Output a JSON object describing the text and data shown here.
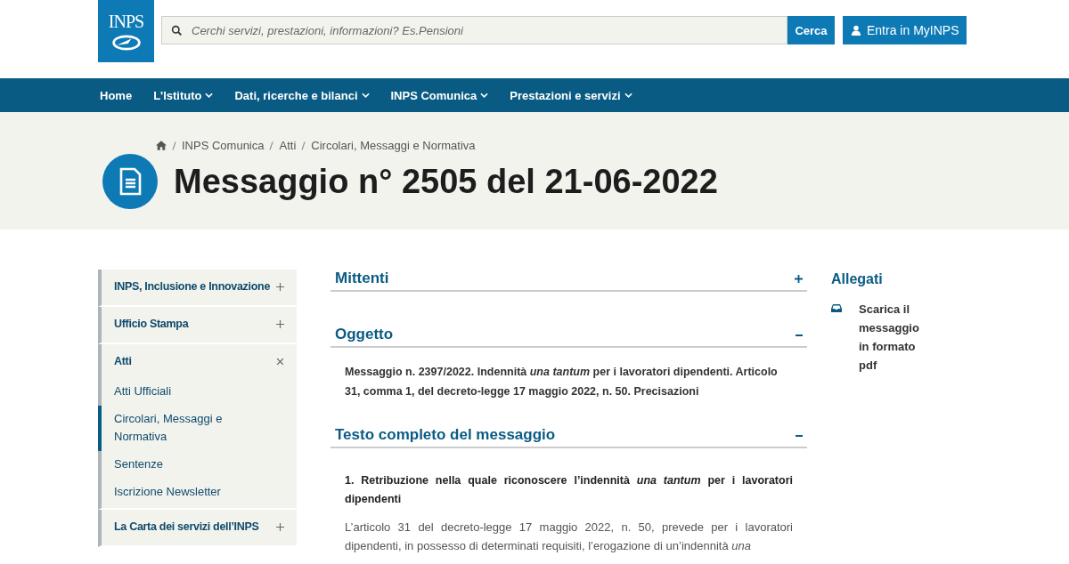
{
  "header": {
    "logo": "INPS",
    "search": {
      "placeholder": "Cerchi servizi, prestazioni, informazioni? Es.Pensioni",
      "button": "Cerca"
    },
    "login_button": "Entra in MyINPS"
  },
  "nav": [
    {
      "label": "Home",
      "has_menu": false
    },
    {
      "label": "L'Istituto",
      "has_menu": true
    },
    {
      "label": "Dati, ricerche e bilanci",
      "has_menu": true
    },
    {
      "label": "INPS Comunica",
      "has_menu": true
    },
    {
      "label": "Prestazioni e servizi",
      "has_menu": true
    }
  ],
  "breadcrumb": [
    "INPS Comunica",
    "Atti",
    "Circolari, Messaggi e Normativa"
  ],
  "title": "Messaggio n° 2505 del 21-06-2022",
  "sidebar": [
    {
      "label": "INPS, Inclusione e Innovazione",
      "expanded": false
    },
    {
      "label": "Ufficio Stampa",
      "expanded": false
    },
    {
      "label": "Atti",
      "expanded": true,
      "children": [
        {
          "label": "Atti Ufficiali",
          "selected": false
        },
        {
          "label": "Circolari, Messaggi e Normativa",
          "selected": true
        },
        {
          "label": "Sentenze",
          "selected": false
        },
        {
          "label": "Iscrizione Newsletter",
          "selected": false
        }
      ]
    },
    {
      "label": "La Carta dei servizi dell’INPS",
      "expanded": false
    }
  ],
  "sections": [
    {
      "title": "Mittenti",
      "expanded": false
    },
    {
      "title": "Oggetto",
      "expanded": true,
      "paragraphs": [
        {
          "kind": "lead",
          "text": "Messaggio n. 2397/2022. Indennità *una tantum* per i lavoratori dipendenti. Articolo 31, comma 1, del decreto-legge 17 maggio 2022, n. 50. Precisazioni"
        }
      ]
    },
    {
      "title": "Testo completo del messaggio",
      "expanded": true,
      "paragraphs": [
        {
          "kind": "heading",
          "text": "1. Retribuzione nella quale riconoscere l’indennità *una tantum* per i lavoratori dipendenti"
        },
        {
          "kind": "body",
          "text": "L’articolo 31 del decreto-legge 17 maggio 2022, n. 50, prevede per i lavoratori dipendenti, in possesso di determinati requisiti, l’erogazione di un’indennità *una*"
        }
      ]
    }
  ],
  "attachments": {
    "title": "Allegati",
    "items": [
      "Scarica il messaggio in formato pdf"
    ]
  }
}
